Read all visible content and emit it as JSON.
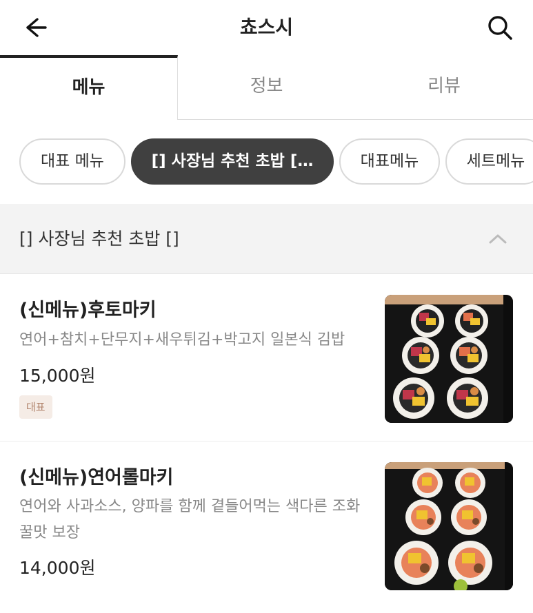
{
  "header": {
    "title": "쵸스시",
    "back_icon": "arrow-left-icon",
    "search_icon": "search-icon"
  },
  "tabs": [
    {
      "label": "메뉴",
      "active": true
    },
    {
      "label": "정보",
      "active": false
    },
    {
      "label": "리뷰",
      "active": false
    }
  ],
  "chips": [
    {
      "label": "대표 메뉴",
      "active": false
    },
    {
      "label": "[] 사장님 추천 초밥 […",
      "active": true
    },
    {
      "label": "대표메뉴",
      "active": false
    },
    {
      "label": "세트메뉴",
      "active": false
    }
  ],
  "section": {
    "title": "[] 사장님 추천 초밥 []",
    "toggle_icon": "chevron-up-icon"
  },
  "items": [
    {
      "name": "(신메뉴)후토마키",
      "description": "연어+참치+단무지+새우튀김+박고지 일본식 김밥",
      "price": "15,000원",
      "badge": "대표",
      "image_icon": "futomaki-photo"
    },
    {
      "name": "(신메뉴)연어롤마키",
      "description": "연어와 사과소스, 양파를 함께 곁들어먹는 색다른 조화 꿀맛 보장",
      "price": "14,000원",
      "image_icon": "salmon-roll-photo"
    }
  ],
  "colors": {
    "active_chip_bg": "#404040",
    "section_bg": "#f3f3f3",
    "badge_bg": "#f5ece6",
    "badge_text": "#b0826a"
  }
}
